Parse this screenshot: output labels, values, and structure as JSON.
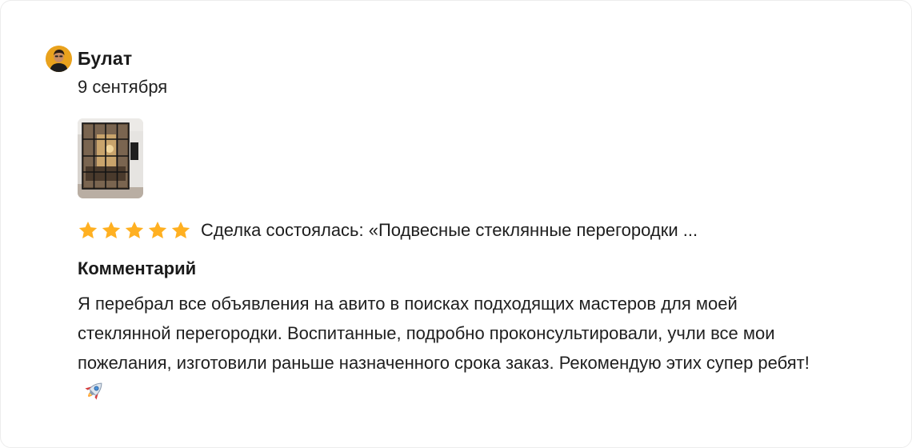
{
  "review": {
    "author": "Булат",
    "date": "9 сентября",
    "rating": 5,
    "rating_max": 5,
    "deal_text": "Сделка состоялась: «Подвесные стеклянные перегородки ...",
    "comment_heading": "Комментарий",
    "comment_text": "Я перебрал все объявления на авито в поисках подходящих мастеров для моей стеклянной перегородки. Воспитанные, подробно проконсультировали, учли все мои пожелания, изготовили раньше назначенного срока заказ. Рекомендую этих супер ребят!",
    "emoji": "rocket-icon"
  },
  "colors": {
    "star": "#ffb021",
    "avatar_bg": "#e9a21d",
    "text": "#1a1a1a"
  }
}
